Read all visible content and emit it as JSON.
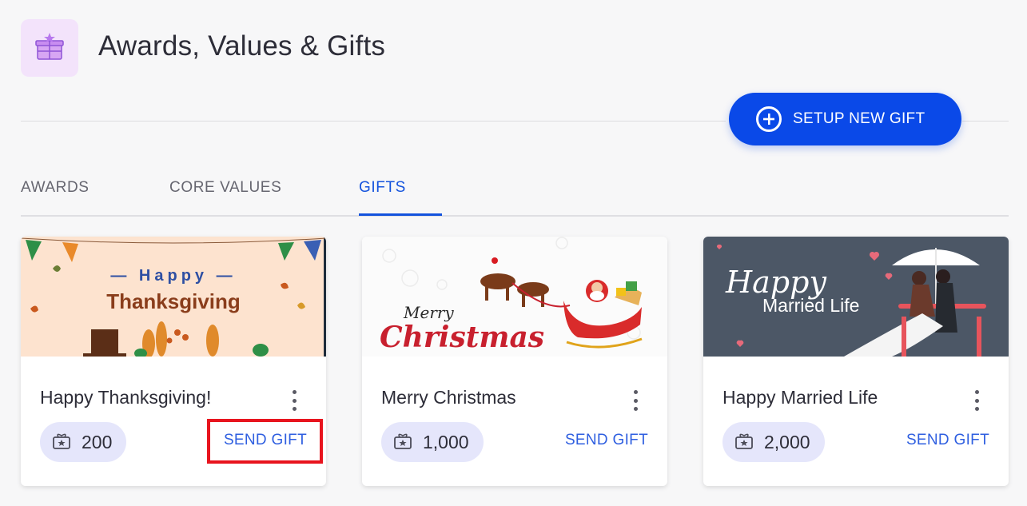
{
  "header": {
    "title": "Awards, Values & Gifts",
    "icon": "gift-box-icon"
  },
  "actions": {
    "setup_label": "SETUP NEW GIFT",
    "setup_icon": "plus-circle-icon"
  },
  "tabs": [
    {
      "label": "AWARDS",
      "active": false
    },
    {
      "label": "CORE VALUES",
      "active": false
    },
    {
      "label": "GIFTS",
      "active": true
    }
  ],
  "gifts": [
    {
      "title": "Happy Thanksgiving!",
      "points": "200",
      "action": "SEND GIFT",
      "banner": {
        "line1": "— Happy —",
        "line2": "Thanksgiving"
      }
    },
    {
      "title": "Merry Christmas",
      "points": "1,000",
      "action": "SEND GIFT",
      "banner": {
        "line1": "Merry",
        "line2": "Christmas"
      }
    },
    {
      "title": "Happy Married Life",
      "points": "2,000",
      "action": "SEND GIFT",
      "banner": {
        "line1": "Happy",
        "line2": "Married Life"
      }
    }
  ],
  "colors": {
    "accent": "#0a49e8",
    "active_tab": "#1453dd",
    "points_pill": "#e5e6fb",
    "highlight": "#e8141e"
  }
}
